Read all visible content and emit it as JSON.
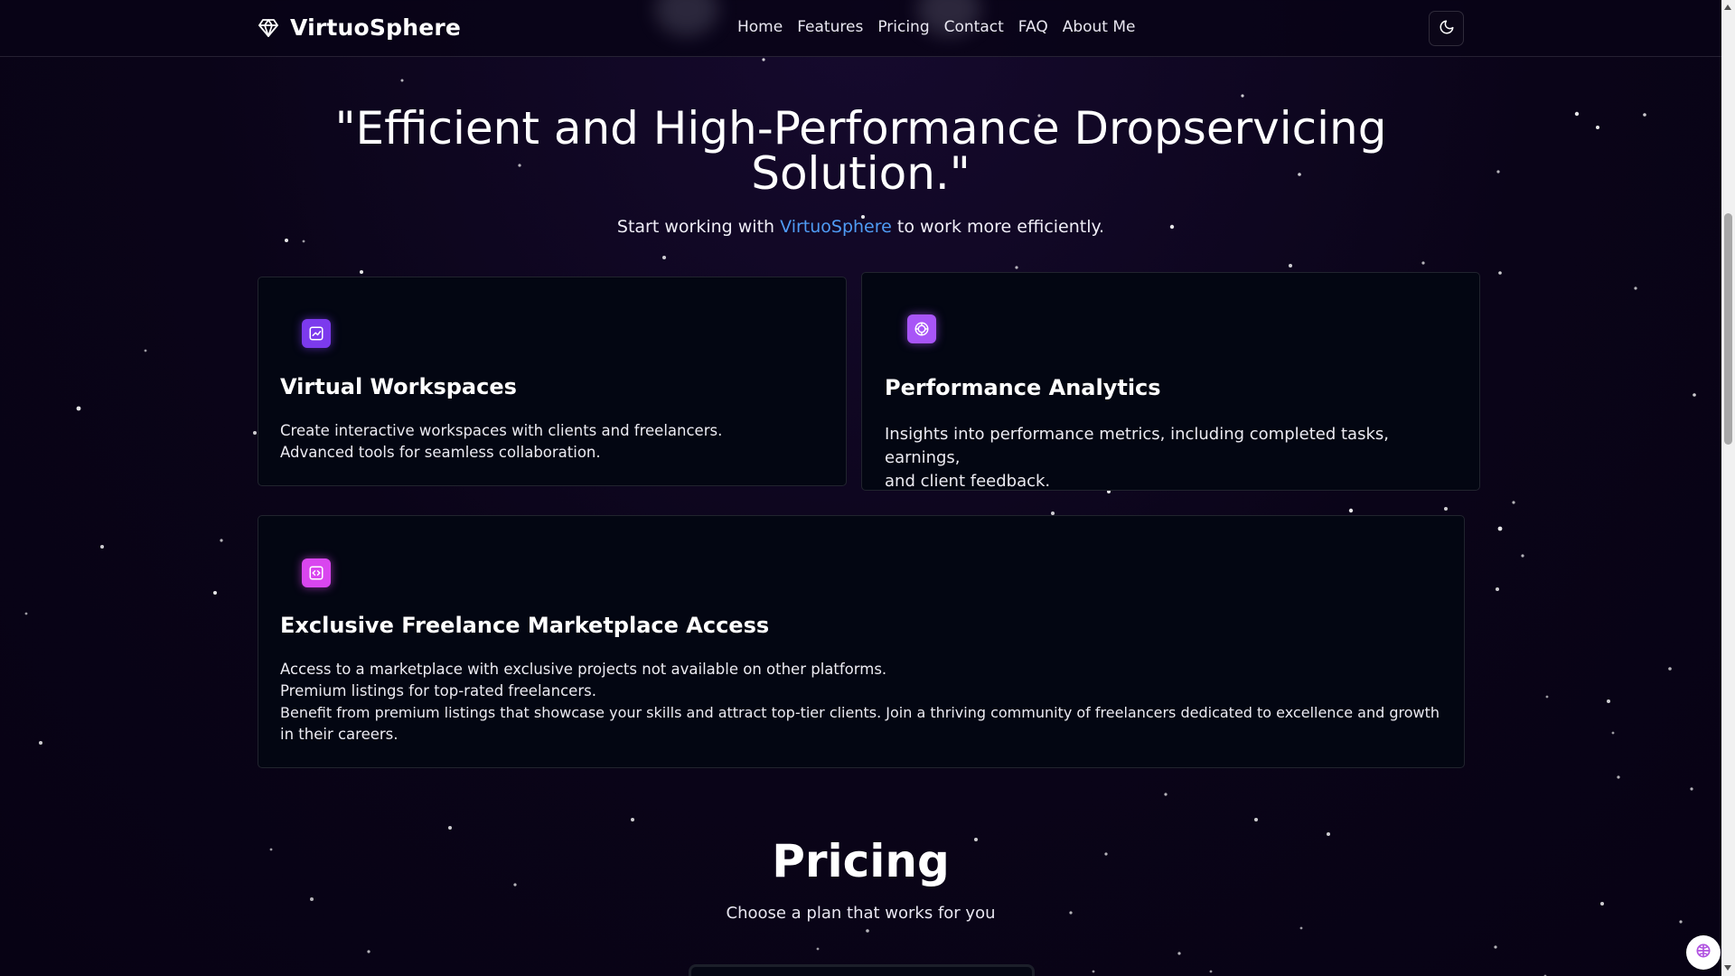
{
  "colors": {
    "background": "#080316",
    "accent_link": "#4f9cf5",
    "icon_purple": "#7c3aed",
    "icon_violet": "#a855f7",
    "icon_pink": "#d946ef",
    "card_bg": "#030612"
  },
  "navbar": {
    "brand": {
      "name": "VirtuoSphere",
      "icon": "diamond-icon"
    },
    "links": [
      "Home",
      "Features",
      "Pricing",
      "Contact",
      "FAQ",
      "About Me"
    ],
    "theme_toggle_icon": "moon-icon"
  },
  "hero": {
    "title_line1": "\"Efficient and High-Performance Dropservicing",
    "title_line2": "Solution.\"",
    "subtitle_before": "Start working with ",
    "subtitle_link": "VirtuoSphere",
    "subtitle_after": " to work more efficiently."
  },
  "features": [
    {
      "icon": "chart-icon",
      "title": "Virtual Workspaces",
      "lines": [
        "Create interactive workspaces with clients and freelancers.",
        "Advanced tools for seamless collaboration."
      ]
    },
    {
      "icon": "target-icon",
      "title": "Performance Analytics",
      "lines": [
        "Insights into performance metrics, including completed tasks, earnings,",
        "and client feedback."
      ]
    },
    {
      "icon": "code-icon",
      "title": "Exclusive Freelance Marketplace Access",
      "lines": [
        "Access to a marketplace with exclusive projects not available on other platforms.",
        "Premium listings for top-rated freelancers.",
        "Benefit from premium listings that showcase your skills and attract top-tier clients. Join a thriving community of freelancers dedicated to excellence and growth",
        "in their careers."
      ]
    }
  ],
  "pricing": {
    "title": "Pricing",
    "subtitle": "Choose a plan that works for you"
  }
}
